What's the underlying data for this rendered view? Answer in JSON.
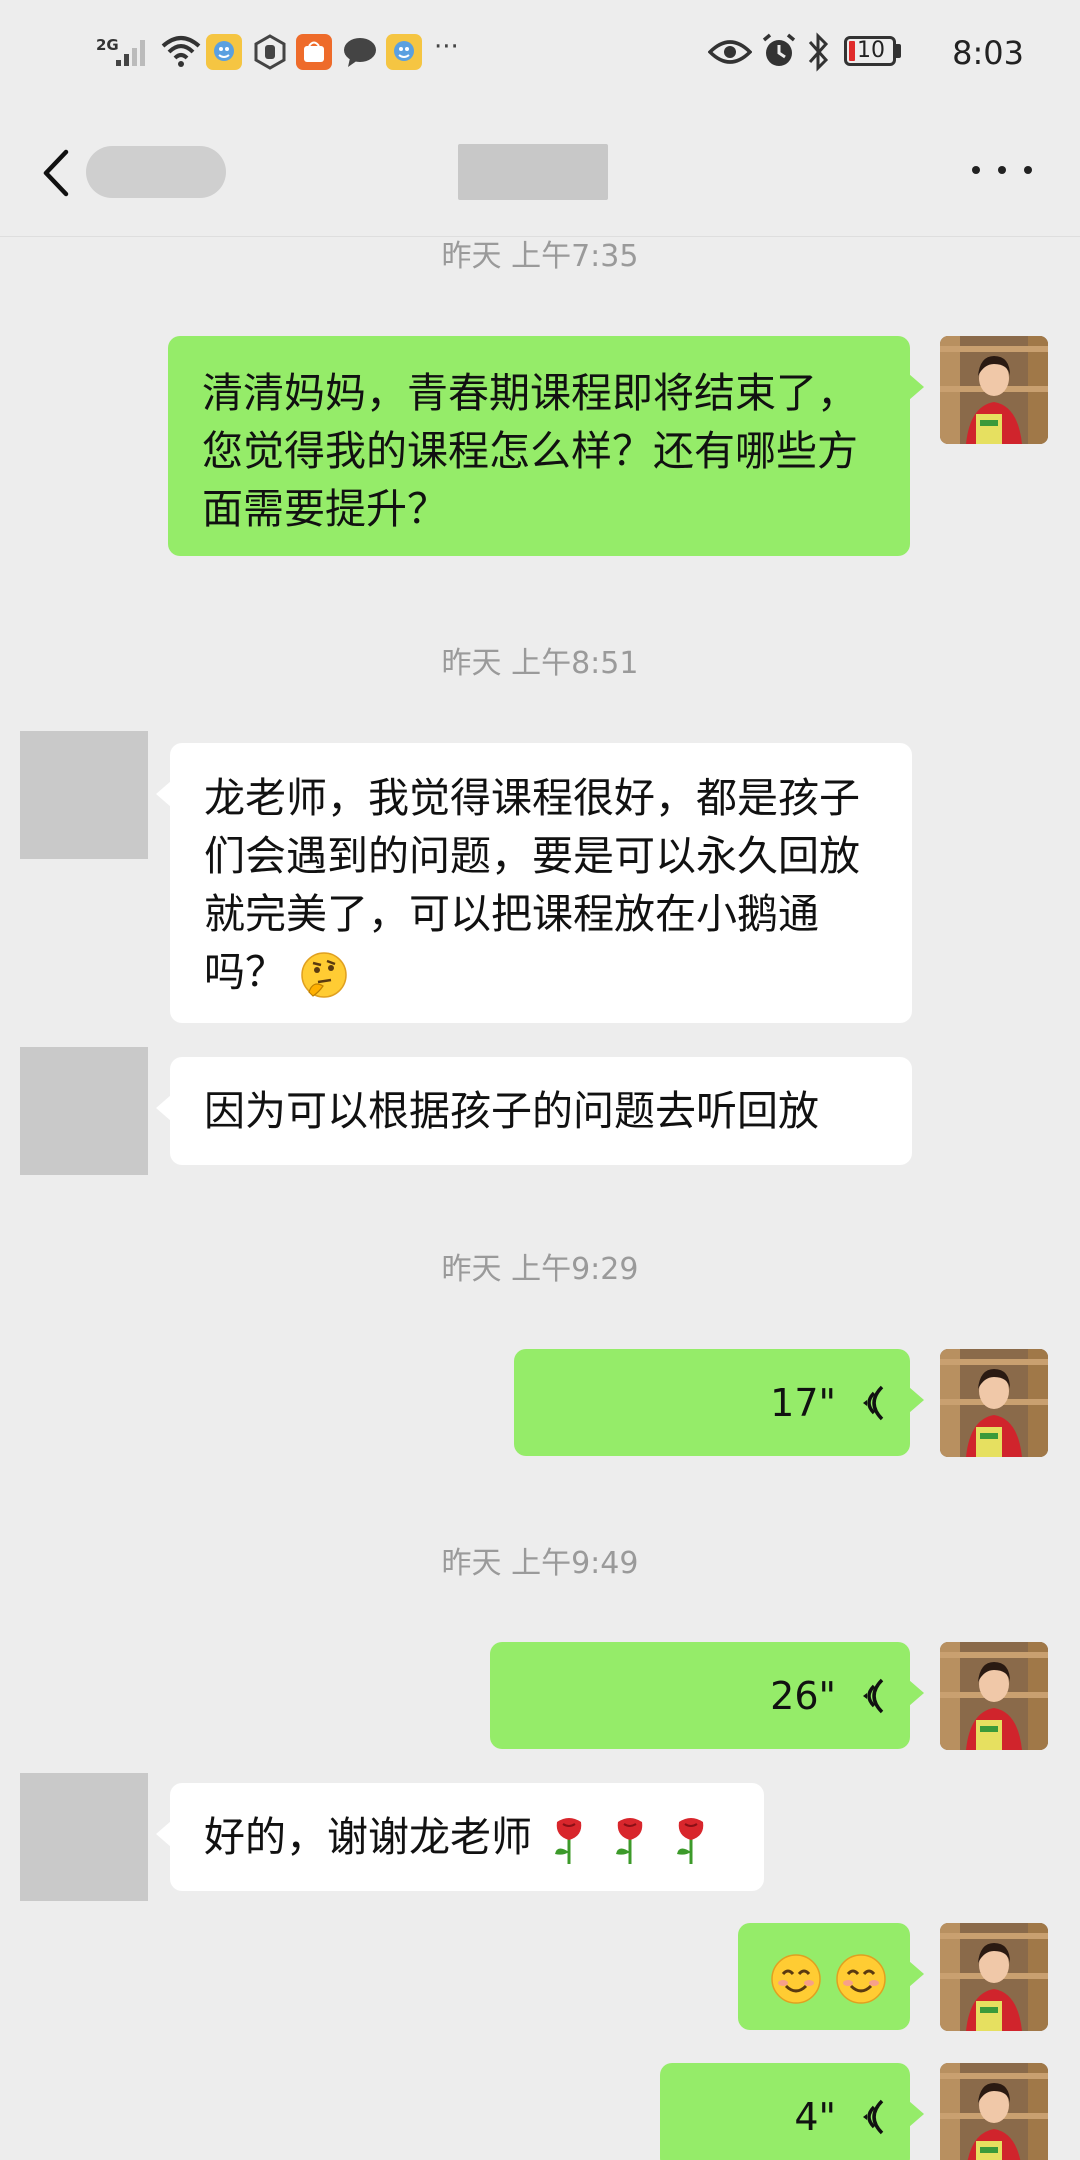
{
  "status_bar": {
    "network": "2G",
    "time": "8:03",
    "battery": "10",
    "overflow": "···"
  },
  "header": {
    "back_icon": "chevron-left-icon",
    "more_icon": "more-icon"
  },
  "messages": [
    {
      "kind": "timestamp",
      "text": "昨天 上午7:35"
    },
    {
      "kind": "text",
      "side": "right",
      "text": "清清妈妈，青春期课程即将结束了，您觉得我的课程怎么样？还有哪些方面需要提升？"
    },
    {
      "kind": "timestamp",
      "text": "昨天 上午8:51"
    },
    {
      "kind": "text",
      "side": "left",
      "text": "龙老师，我觉得课程很好，都是孩子们会遇到的问题，要是可以永久回放就完美了，可以把课程放在小鹅通吗？",
      "emoji": "thinking-face"
    },
    {
      "kind": "text",
      "side": "left",
      "text": "因为可以根据孩子的问题去听回放"
    },
    {
      "kind": "timestamp",
      "text": "昨天 上午9:29"
    },
    {
      "kind": "voice",
      "side": "right",
      "duration": "17\""
    },
    {
      "kind": "timestamp",
      "text": "昨天 上午9:49"
    },
    {
      "kind": "voice",
      "side": "right",
      "duration": "26\""
    },
    {
      "kind": "text",
      "side": "left",
      "text": "好的，谢谢龙老师",
      "emoji": "rose x3"
    },
    {
      "kind": "emoji",
      "side": "right",
      "emoji": "smiling-face x2"
    },
    {
      "kind": "voice",
      "side": "right",
      "duration": "4\""
    }
  ],
  "colors": {
    "background": "#ededed",
    "sent_bubble": "#95ec69",
    "received_bubble": "#ffffff",
    "timestamp": "#9a9a9a"
  }
}
